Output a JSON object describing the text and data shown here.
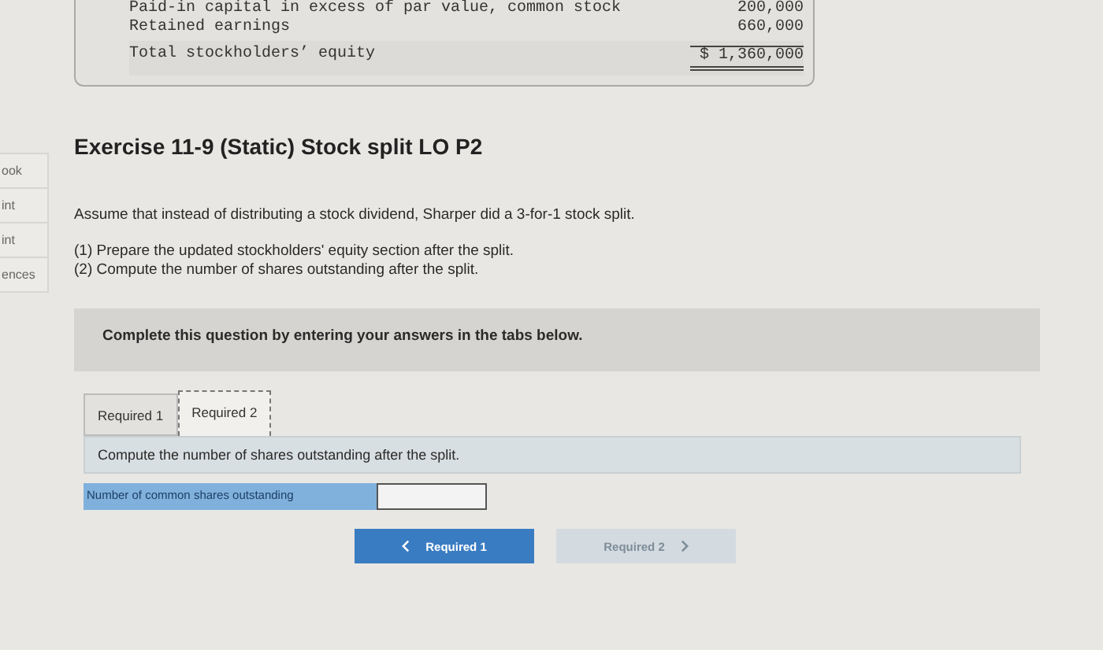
{
  "sidebar": {
    "items": [
      {
        "label": "ook"
      },
      {
        "label": "int"
      },
      {
        "label": "int"
      },
      {
        "label": "ences"
      }
    ]
  },
  "previous_table": {
    "rows": [
      {
        "label": "Paid-in capital in excess of par value, common stock",
        "amount": "200,000",
        "kind": "plain"
      },
      {
        "label": "Retained earnings",
        "amount": "660,000",
        "kind": "plain"
      },
      {
        "label": "Total stockholders’ equity",
        "amount": "$ 1,360,000",
        "kind": "total"
      }
    ]
  },
  "title": "Exercise 11-9 (Static) Stock split LO P2",
  "intro": "Assume that instead of distributing a stock dividend, Sharper did a 3-for-1 stock split.",
  "tasks": [
    "(1) Prepare the updated stockholders' equity section after the split.",
    "(2) Compute the number of shares outstanding after the split."
  ],
  "instruction": "Complete this question by entering your answers in the tabs below.",
  "tabs": [
    {
      "label": "Required 1",
      "selected": false
    },
    {
      "label": "Required 2",
      "selected": true
    }
  ],
  "question": "Compute the number of shares outstanding after the split.",
  "answer_row": {
    "label": "Number of common shares outstanding"
  },
  "nav_buttons": [
    {
      "label": "Required 1",
      "kind": "prev",
      "disabled": false
    },
    {
      "label": "Required 2",
      "kind": "next",
      "disabled": true
    }
  ]
}
